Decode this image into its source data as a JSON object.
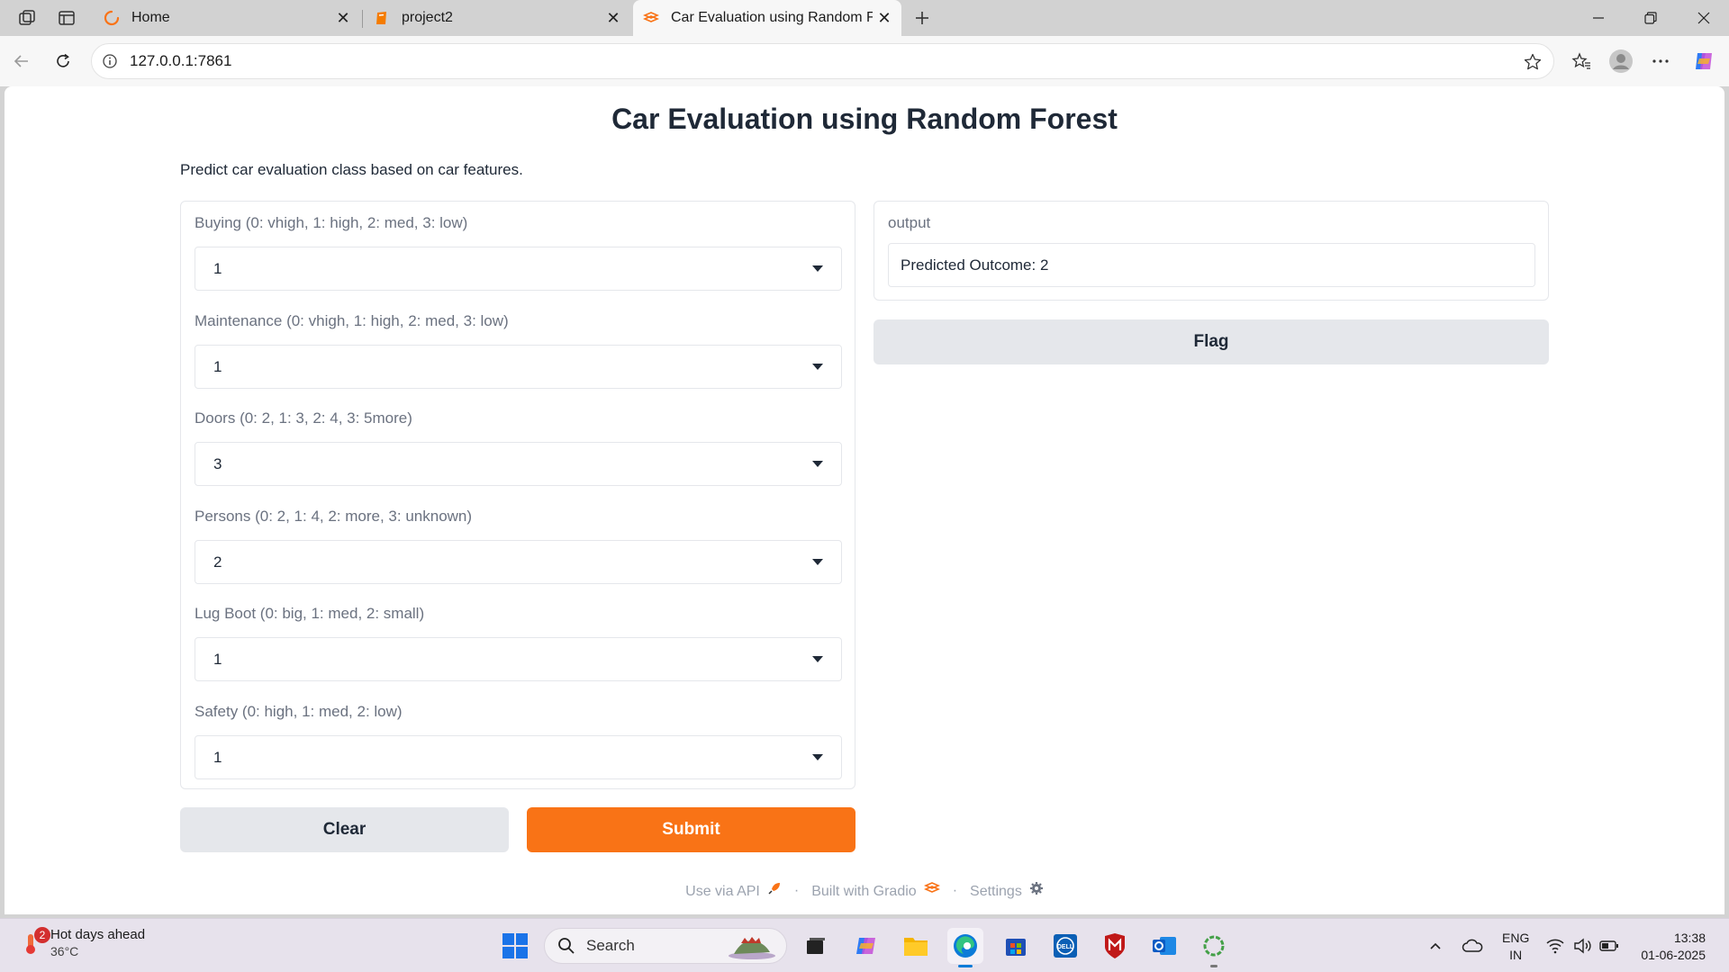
{
  "browser": {
    "tabs": [
      {
        "label": "Home"
      },
      {
        "label": "project2"
      },
      {
        "label": "Car Evaluation using Random Forest"
      }
    ],
    "url": "127.0.0.1:7861"
  },
  "app": {
    "title": "Car Evaluation using Random Forest",
    "description": "Predict car evaluation class based on car features.",
    "inputs": [
      {
        "label": "Buying (0: vhigh, 1: high, 2: med, 3: low)",
        "value": "1"
      },
      {
        "label": "Maintenance (0: vhigh, 1: high, 2: med, 3: low)",
        "value": "1"
      },
      {
        "label": "Doors (0: 2, 1: 3, 2: 4, 3: 5more)",
        "value": "3"
      },
      {
        "label": "Persons (0: 2, 1: 4, 2: more, 3: unknown)",
        "value": "2"
      },
      {
        "label": "Lug Boot (0: big, 1: med, 2: small)",
        "value": "1"
      },
      {
        "label": "Safety (0: high, 1: med, 2: low)",
        "value": "1"
      }
    ],
    "output": {
      "label": "output",
      "value": "Predicted Outcome: 2"
    },
    "buttons": {
      "flag": "Flag",
      "clear": "Clear",
      "submit": "Submit"
    },
    "footer": {
      "api": "Use via API",
      "built": "Built with Gradio",
      "settings": "Settings"
    },
    "colors": {
      "accent": "#f97316",
      "secondary": "#e5e7eb"
    }
  },
  "taskbar": {
    "weather": {
      "title": "Hot days ahead",
      "temp": "36°C",
      "badge": "2"
    },
    "search_placeholder": "Search",
    "language": {
      "line1": "ENG",
      "line2": "IN"
    },
    "clock": {
      "time": "13:38",
      "date": "01-06-2025"
    }
  }
}
